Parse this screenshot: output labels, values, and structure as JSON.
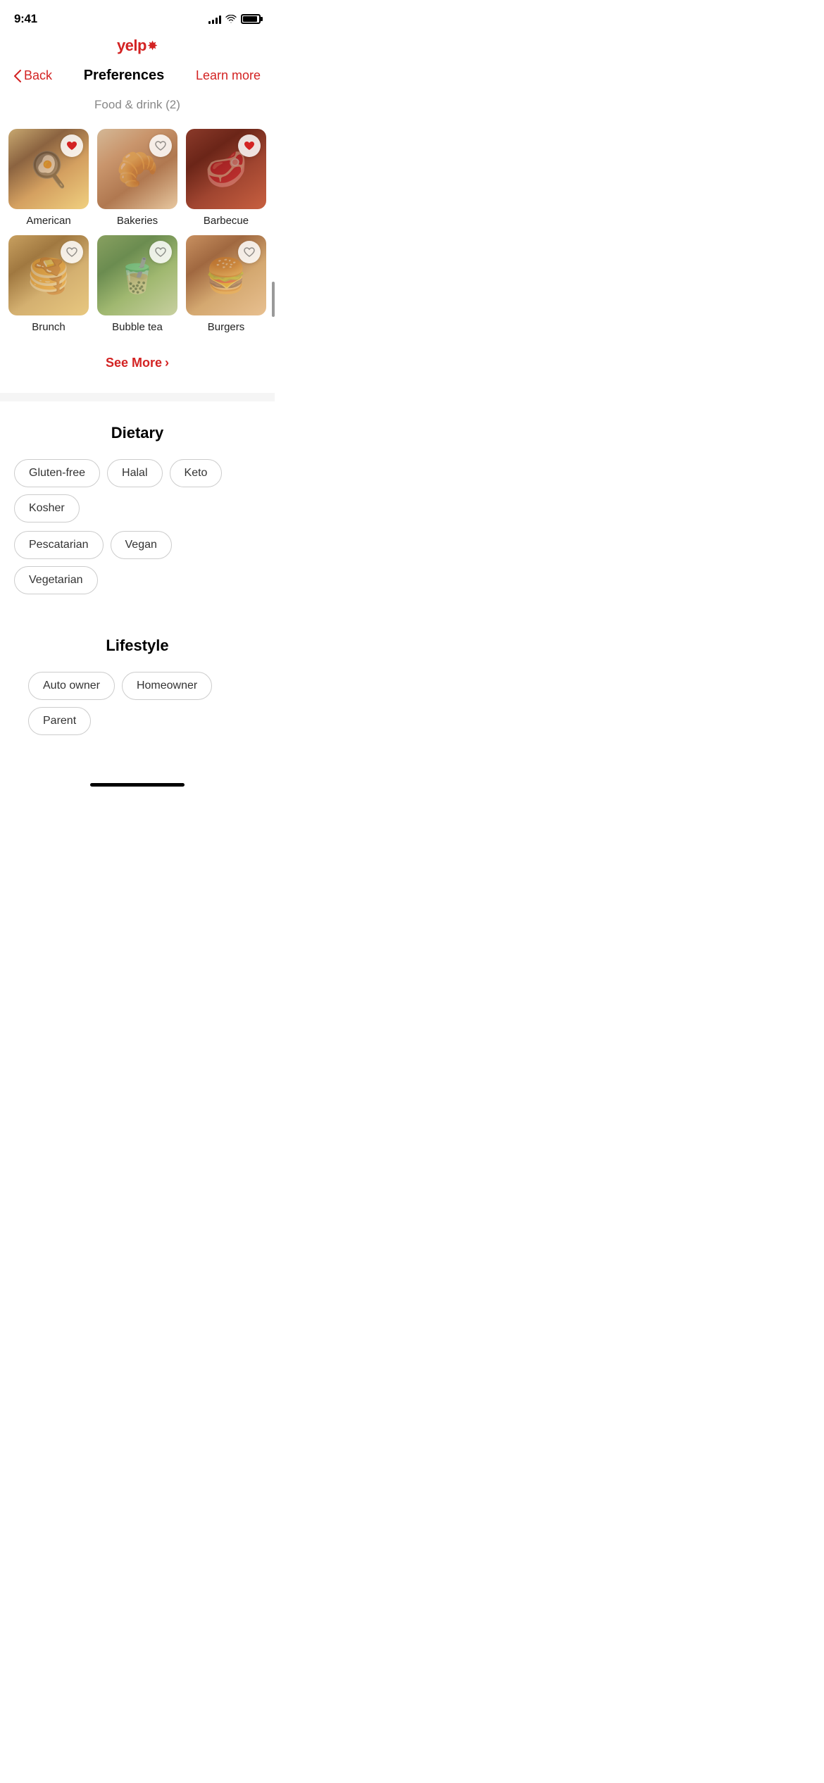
{
  "statusBar": {
    "time": "9:41",
    "signalBars": [
      4,
      6,
      8,
      10,
      12
    ],
    "hasWifi": true,
    "batteryFull": true
  },
  "header": {
    "yelpLogo": "yelp",
    "backLabel": "Back",
    "title": "Preferences",
    "learnMore": "Learn more"
  },
  "foodSection": {
    "subtitle": "Food & drink (2)",
    "items": [
      {
        "id": "american",
        "label": "American",
        "heartFilled": true,
        "cssClass": "food-american"
      },
      {
        "id": "bakeries",
        "label": "Bakeries",
        "heartFilled": false,
        "cssClass": "food-bakeries"
      },
      {
        "id": "barbecue",
        "label": "Barbecue",
        "heartFilled": true,
        "cssClass": "food-barbecue"
      },
      {
        "id": "brunch",
        "label": "Brunch",
        "heartFilled": false,
        "cssClass": "food-brunch"
      },
      {
        "id": "bubbletea",
        "label": "Bubble tea",
        "heartFilled": false,
        "cssClass": "food-bubbletea"
      },
      {
        "id": "burgers",
        "label": "Burgers",
        "heartFilled": false,
        "cssClass": "food-burgers"
      }
    ],
    "seeMore": "See More"
  },
  "dietarySection": {
    "title": "Dietary",
    "pills": [
      {
        "id": "gluten-free",
        "label": "Gluten-free"
      },
      {
        "id": "halal",
        "label": "Halal"
      },
      {
        "id": "keto",
        "label": "Keto"
      },
      {
        "id": "kosher",
        "label": "Kosher"
      },
      {
        "id": "pescatarian",
        "label": "Pescatarian"
      },
      {
        "id": "vegan",
        "label": "Vegan"
      },
      {
        "id": "vegetarian",
        "label": "Vegetarian"
      }
    ]
  },
  "lifestyleSection": {
    "title": "Lifestyle",
    "pills": [
      {
        "id": "auto-owner",
        "label": "Auto owner"
      },
      {
        "id": "homeowner",
        "label": "Homeowner"
      },
      {
        "id": "parent",
        "label": "Parent"
      }
    ]
  }
}
